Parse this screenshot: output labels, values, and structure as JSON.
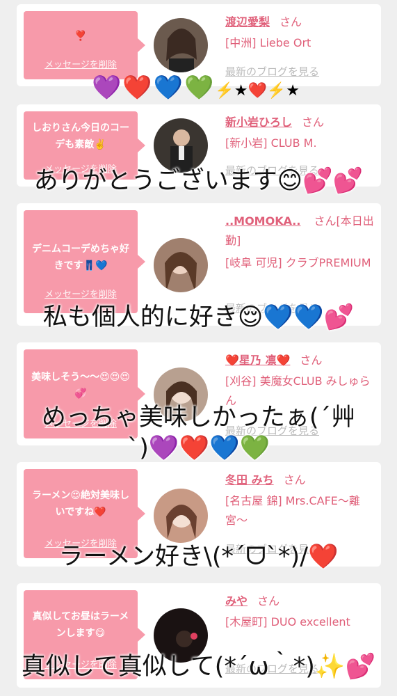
{
  "delete_label": "メッセージを削除",
  "blog_label": "最新のブログを見る",
  "san_label": "さん",
  "cards": [
    {
      "message": "❣️",
      "name": "渡辺愛梨",
      "shop": "[中洲] Liebe Ort",
      "avatar_color": "#6b5a4e"
    },
    {
      "message": "しおりさん今日のコーデも素敵✌️",
      "name": "新小岩ひろし",
      "shop": "[新小岩] CLUB M.",
      "avatar_color": "#3a3530"
    },
    {
      "message": "デニムコーデめちゃ好きです👖💙",
      "name": "..MOMOKA..",
      "name_suffix": "さん[本日出勤]",
      "shop": "[岐阜 可児] クラブPREMIUM",
      "avatar_color": "#a0806e"
    },
    {
      "message": "美味しそう〜〜😍😍😍💞",
      "name": "❤️星乃 凛❤️",
      "shop": "[刈谷] 美魔女CLUB みしゅらん",
      "avatar_color": "#b8a090"
    },
    {
      "message": "ラーメン😍絶対美味しいですね❤️",
      "name": "冬田 みち",
      "shop": "[名古屋 錦] Mrs.CAFE〜離宮〜",
      "avatar_color": "#c89a85"
    },
    {
      "message": "真似してお昼はラーメンします😋",
      "name": "みや",
      "shop": "[木屋町] DUO excellent",
      "avatar_color": "#1a1212"
    }
  ],
  "overlay": {
    "hearts_row": [
      "💜",
      "❤️",
      "💙",
      "💚"
    ],
    "hearts_row_tail": "⚡️★❤️⚡️★",
    "line1": "ありがとうございます😊💕💕",
    "line2": "私も個人的に好き😌💙💙💕",
    "line3a": "めっちゃ美味しかったぁ(´艸",
    "line3b": "`)💜❤️💙💚",
    "line4": "ラーメン好き\\(*ˊᗜˋ*)/❤️",
    "line5": "真似して真似して(*´ω｀*)✨💕"
  }
}
